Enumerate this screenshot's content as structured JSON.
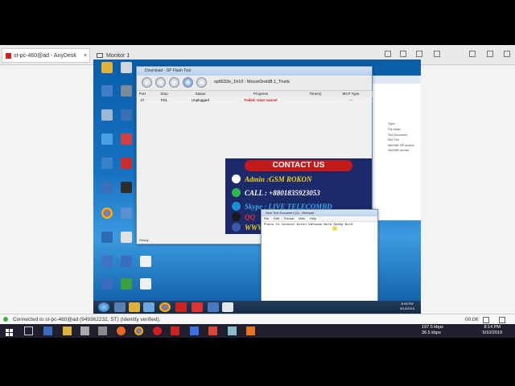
{
  "anydesk": {
    "tab_active": "st-pc-460@ad - AnyDesk",
    "tab_monitor": "Monitor 1",
    "status_text": "Connected to st-pc-460@ad (949362232, ST) (Identity verified).",
    "bottom_right_time": "00:06"
  },
  "flash_tool": {
    "title": "Download - SP Flash Tool",
    "project": "sp6632e_1h10 : MocorDroid8.1_Trunk",
    "columns": [
      "Port",
      "Step",
      "Status",
      "Progress",
      "Time(s)",
      "MCP Type"
    ],
    "row": {
      "port": "27",
      "step": "FDL",
      "status": "Unplugged",
      "progress": "Failed: User cancel",
      "time": "",
      "mcp": "---"
    },
    "ready_label": "Ready"
  },
  "banner": {
    "heading": "CONTACT US",
    "admin": "Admin :GSM ROKON",
    "call": "CALL : +8801835923053",
    "skype": "Skype : LIVE TELECOMBD",
    "qq": "QQ",
    "www": "WWW",
    "colors": {
      "bg": "#1c2a6a",
      "head": "#c41a1a",
      "admin": "#f0d020",
      "call": "#ffffff"
    }
  },
  "notepad": {
    "title": "New Text Document (2) - Notepad",
    "menu": [
      "File",
      "Edit",
      "Format",
      "View",
      "Help"
    ],
    "content": "Phone To Connect Koren Vafasem Bore Skeep Kore"
  },
  "explorer": {
    "type_header": "Type",
    "rows": [
      "File folder",
      "Text Document",
      "PAC File",
      "WinRAR ZIP archive",
      "WinRAR archive"
    ]
  },
  "remote_clock": {
    "time": "8:43 PM",
    "date": "5/14/2019"
  },
  "windows": {
    "net_up": "197.5 kbps",
    "net_down": "36.5 kbps",
    "time": "8:14 PM",
    "date": "5/10/2019"
  }
}
